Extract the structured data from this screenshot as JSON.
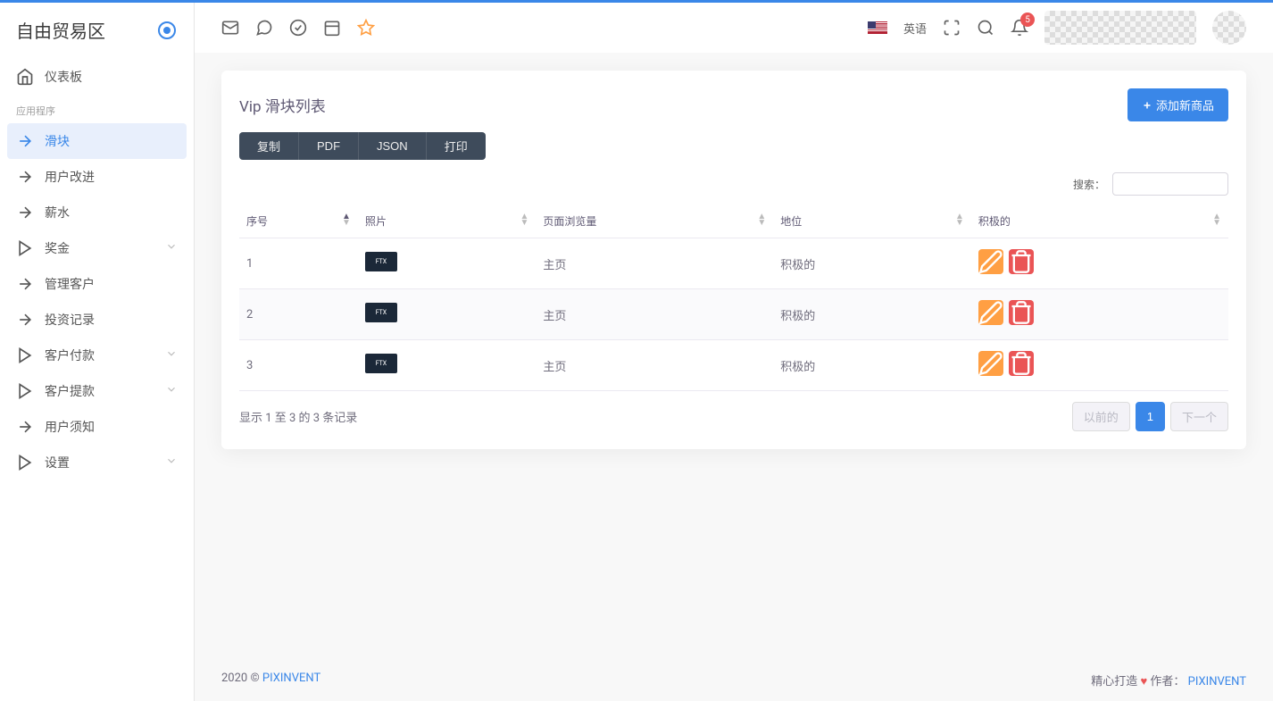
{
  "brand": {
    "title": "自由贸易区"
  },
  "nav": {
    "dashboard": "仪表板",
    "section_app": "应用程序",
    "slider": "滑块",
    "user_improve": "用户改进",
    "salary": "薪水",
    "bonus": "奖金",
    "manage_customer": "管理客户",
    "invest_record": "投资记录",
    "customer_pay": "客户付款",
    "customer_withdraw": "客户提款",
    "user_notice": "用户须知",
    "settings": "设置"
  },
  "topbar": {
    "language": "英语",
    "notif_count": "5"
  },
  "card": {
    "title": "Vip 滑块列表",
    "add_btn": "添加新商品",
    "export": {
      "copy": "复制",
      "pdf": "PDF",
      "json": "JSON",
      "print": "打印"
    },
    "search_label": "搜索："
  },
  "table": {
    "headers": {
      "sn": "序号",
      "photo": "照片",
      "pageview": "页面浏览量",
      "status": "地位",
      "positive": "积极的"
    },
    "rows": [
      {
        "sn": "1",
        "pageview": "主页",
        "status": "积极的"
      },
      {
        "sn": "2",
        "pageview": "主页",
        "status": "积极的"
      },
      {
        "sn": "3",
        "pageview": "主页",
        "status": "积极的"
      }
    ],
    "info": "显示 1 至 3 的 3 条记录",
    "prev": "以前的",
    "page1": "1",
    "next": "下一个"
  },
  "footer": {
    "left_year": "2020 © ",
    "left_brand": "PIXINVENT",
    "right_made": "精心打造",
    "right_author": "作者：",
    "right_brand": "PIXINVENT"
  }
}
